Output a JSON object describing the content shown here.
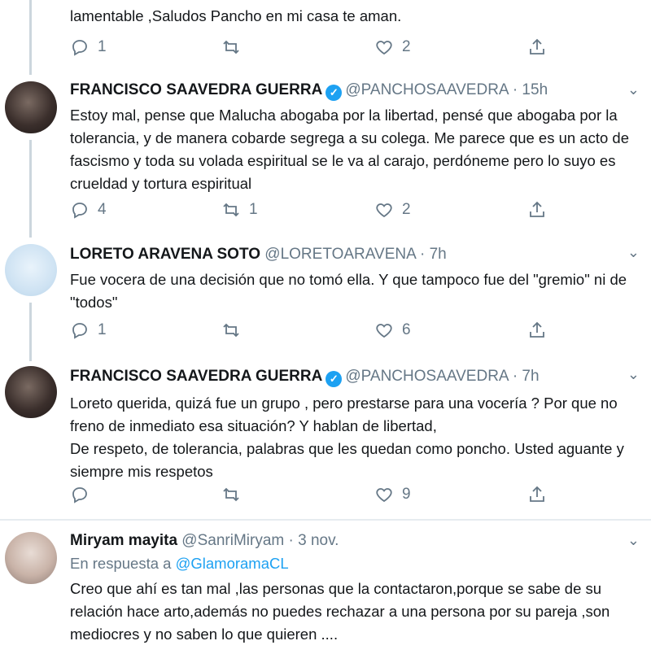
{
  "top_fragment": {
    "text": "lamentable ,Saludos Pancho en mi casa te aman.",
    "replies": "1",
    "retweets": "",
    "likes": "2"
  },
  "tweets": [
    {
      "name": "FRANCISCO SAAVEDRA GUERRA",
      "verified": true,
      "handle": "@PANCHOSAAVEDRA",
      "time": "· 15h",
      "text": "Estoy mal, pense que Malucha abogaba por la libertad, pensé que abogaba por la tolerancia, y de manera cobarde segrega a su colega. Me parece que es un acto de fascismo y toda su volada espiritual se le va al carajo, perdóneme pero lo suyo es crueldad y tortura espiritual",
      "replies": "4",
      "retweets": "1",
      "likes": "2"
    },
    {
      "name": "LORETO ARAVENA SOTO",
      "verified": false,
      "handle": "@LORETOARAVENA",
      "time": "· 7h",
      "text": "Fue vocera de una decisión que no tomó ella. Y que tampoco fue del \"gremio\" ni de \"todos\"",
      "replies": "1",
      "retweets": "",
      "likes": "6"
    },
    {
      "name": "FRANCISCO SAAVEDRA GUERRA",
      "verified": true,
      "handle": "@PANCHOSAAVEDRA",
      "time": "· 7h",
      "text_lines": [
        "Loreto querida, quizá fue un grupo , pero prestarse para una vocería ? Por que no freno de inmediato esa situación? Y hablan de libertad,",
        "De respeto, de tolerancia, palabras que les quedan como poncho. Usted aguante y siempre mis respetos"
      ],
      "replies": "",
      "retweets": "",
      "likes": "9"
    },
    {
      "name": "Miryam mayita",
      "verified": false,
      "handle": "@SanriMiryam",
      "time": "· 3 nov.",
      "reply_prefix": "En respuesta a",
      "reply_link": "@GlamoramaCL",
      "text": "Creo que ahí  es tan mal ,las personas que la contactaron,porque se sabe de su relación  hace arto,además  no puedes rechazar a una persona por su pareja ,son mediocres y no saben lo que quieren ...."
    }
  ],
  "icons": {
    "reply": "reply-icon",
    "retweet": "retweet-icon",
    "like": "heart-icon",
    "share": "share-icon",
    "caret": "chevron-down-icon",
    "verified": "verified-badge-icon"
  },
  "colors": {
    "accent": "#1da1f2",
    "muted": "#657786",
    "thread": "#ccd6dd"
  }
}
